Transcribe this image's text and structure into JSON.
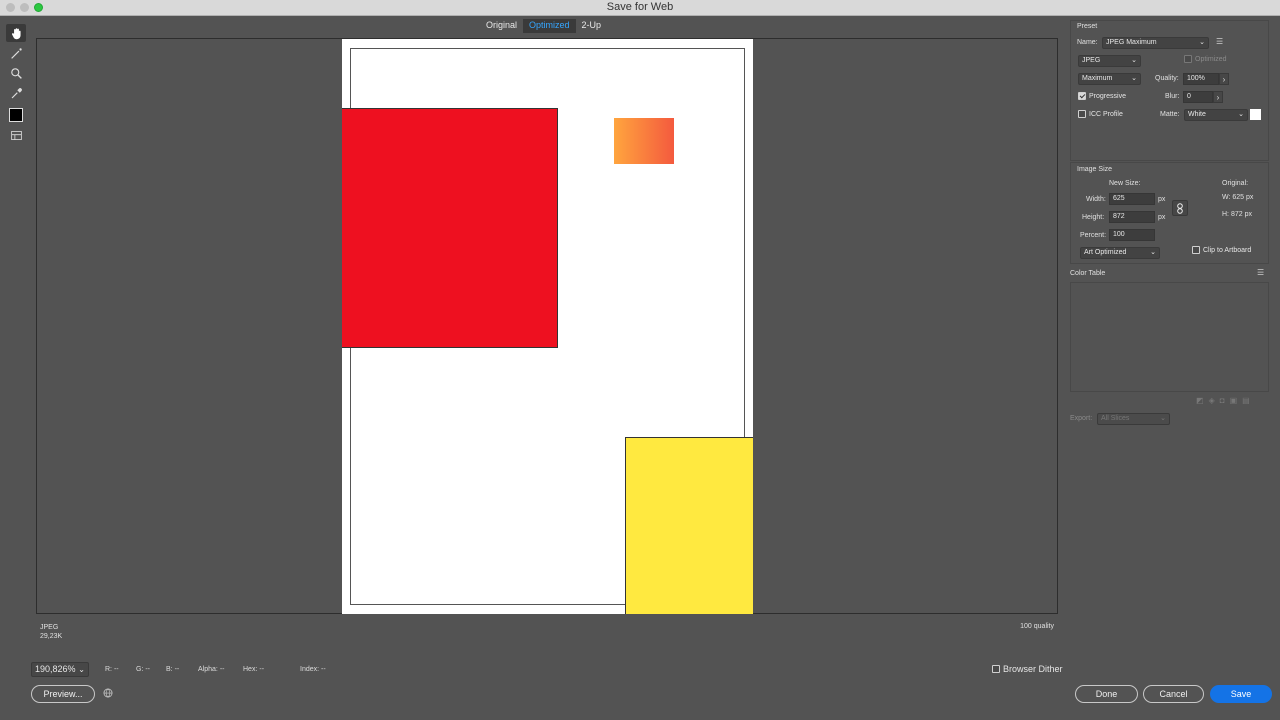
{
  "window": {
    "title": "Save for Web"
  },
  "tabs": [
    "Original",
    "Optimized",
    "2-Up"
  ],
  "tools": [
    "hand-icon",
    "slice-select-icon",
    "zoom-icon",
    "eyedropper-icon"
  ],
  "canvas_info": {
    "format": "JPEG",
    "size": "29,23K",
    "quality": "100 quality"
  },
  "bottom": {
    "zoom": "190,826%",
    "readouts": [
      {
        "label": "R:",
        "value": "--"
      },
      {
        "label": "G:",
        "value": "--"
      },
      {
        "label": "B:",
        "value": "--"
      },
      {
        "label": "Alpha:",
        "value": "--"
      },
      {
        "label": "Hex:",
        "value": "--"
      },
      {
        "label": "Index:",
        "value": "--"
      }
    ],
    "browser_dither": "Browser Dither",
    "preview_label": "Preview...",
    "done_label": "Done",
    "cancel_label": "Cancel",
    "save_label": "Save"
  },
  "preset": {
    "title": "Preset",
    "name_label": "Name:",
    "name_value": "JPEG Maximum",
    "format_value": "JPEG",
    "optimized_label": "Optimized",
    "quality_level": "Maximum",
    "quality_label": "Quality:",
    "quality_value": "100%",
    "progressive_label": "Progressive",
    "blur_label": "Blur:",
    "blur_value": "0",
    "icc_label": "ICC Profile",
    "matte_label": "Matte:",
    "matte_value": "White"
  },
  "image_size": {
    "title": "Image Size",
    "new_size_label": "New Size:",
    "original_label": "Original:",
    "width_label": "Width:",
    "width_value": "625",
    "height_label": "Height:",
    "height_value": "872",
    "unit": "px",
    "percent_label": "Percent:",
    "percent_value": "100",
    "orig_w": "W:  625 px",
    "orig_h": "H:  872 px",
    "resample_value": "Art Optimized",
    "clip_label": "Clip to Artboard"
  },
  "color_table": {
    "title": "Color Table"
  },
  "export": {
    "label": "Export:",
    "value": "All Slices"
  },
  "colors": {
    "accent": "#1473e6",
    "tab_active": "#35a6ff",
    "red": "#ee1020",
    "yellow": "#ffe940",
    "orange_start": "#ffa53e",
    "orange_end": "#f45a3e"
  }
}
